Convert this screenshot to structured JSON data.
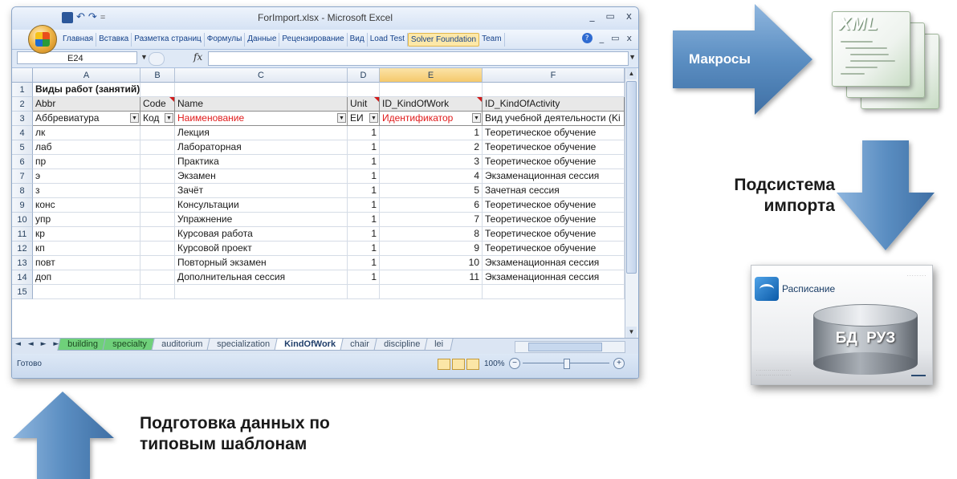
{
  "window": {
    "title": "ForImport.xlsx - Microsoft Excel",
    "undo_glyph": "↶",
    "redo_glyph": "↷",
    "controls": [
      "_",
      "▭",
      "x"
    ],
    "ribbon_controls": [
      "_",
      "▭",
      "x"
    ]
  },
  "ribbon": {
    "tabs": [
      "Главная",
      "Вставка",
      "Разметка страниц",
      "Формулы",
      "Данные",
      "Рецензирование",
      "Вид",
      "Load Test",
      "Solver Foundation",
      "Team"
    ],
    "highlighted_tab": "Solver Foundation"
  },
  "formula_bar": {
    "name_box": "E24",
    "fx": "fx",
    "value": ""
  },
  "grid": {
    "columns": [
      "A",
      "B",
      "C",
      "D",
      "E",
      "F"
    ],
    "selected_column": "E",
    "rows": [
      {
        "n": "1",
        "cells": [
          "Виды работ (занятий)",
          "",
          "",
          "",
          "",
          ""
        ]
      },
      {
        "n": "2",
        "cells": [
          "Abbr",
          "Code",
          "Name",
          "Unit",
          "ID_KindOfWork",
          "ID_KindOfActivity"
        ]
      },
      {
        "n": "3",
        "cells": [
          "Аббревиатура",
          "Код",
          "Наименование",
          "ЕИ",
          "Идентификатор",
          "Вид учебной деятельности (Ki"
        ]
      },
      {
        "n": "4",
        "cells": [
          "лк",
          "",
          "Лекция",
          "1",
          "1",
          "Теоретическое обучение"
        ]
      },
      {
        "n": "5",
        "cells": [
          "лаб",
          "",
          "Лабораторная",
          "1",
          "2",
          "Теоретическое обучение"
        ]
      },
      {
        "n": "6",
        "cells": [
          "пр",
          "",
          "Практика",
          "1",
          "3",
          "Теоретическое обучение"
        ]
      },
      {
        "n": "7",
        "cells": [
          "э",
          "",
          "Экзамен",
          "1",
          "4",
          "Экзаменационная сессия"
        ]
      },
      {
        "n": "8",
        "cells": [
          "з",
          "",
          "Зачёт",
          "1",
          "5",
          "Зачетная сессия"
        ]
      },
      {
        "n": "9",
        "cells": [
          "конс",
          "",
          "Консультации",
          "1",
          "6",
          "Теоретическое обучение"
        ]
      },
      {
        "n": "10",
        "cells": [
          "упр",
          "",
          "Упражнение",
          "1",
          "7",
          "Теоретическое обучение"
        ]
      },
      {
        "n": "11",
        "cells": [
          "кр",
          "",
          "Курсовая работа",
          "1",
          "8",
          "Теоретическое обучение"
        ]
      },
      {
        "n": "12",
        "cells": [
          "кп",
          "",
          "Курсовой проект",
          "1",
          "9",
          "Теоретическое обучение"
        ]
      },
      {
        "n": "13",
        "cells": [
          "повт",
          "",
          "Повторный экзамен",
          "1",
          "10",
          "Экзаменационная сессия"
        ]
      },
      {
        "n": "14",
        "cells": [
          "доп",
          "",
          "Дополнительная сессия",
          "1",
          "11",
          "Экзаменационная сессия"
        ]
      },
      {
        "n": "15",
        "cells": [
          "",
          "",
          "",
          "",
          "",
          ""
        ]
      }
    ]
  },
  "sheet_tabs": [
    {
      "name": "building",
      "style": "green"
    },
    {
      "name": "specialty",
      "style": "green"
    },
    {
      "name": "auditorium",
      "style": "normal"
    },
    {
      "name": "specialization",
      "style": "normal"
    },
    {
      "name": "KindOfWork",
      "style": "active"
    },
    {
      "name": "chair",
      "style": "normal"
    },
    {
      "name": "discipline",
      "style": "normal"
    },
    {
      "name": "lei",
      "style": "normal"
    }
  ],
  "sheet_nav": "◄ ◄ ► ►",
  "status": {
    "text": "Готово",
    "zoom": "100%",
    "zoom_level": 0.5
  },
  "diagram": {
    "macros_label": "Макросы",
    "import_label_line1": "Подсистема",
    "import_label_line2": "импорта",
    "prep_label_line1": "Подготовка данных по",
    "prep_label_line2": "типовым шаблонам",
    "xml_tag": "XML",
    "app_title": "Расписание",
    "db_label": "БД  РУЗ",
    "arrow_color": "#5b8ec2"
  }
}
